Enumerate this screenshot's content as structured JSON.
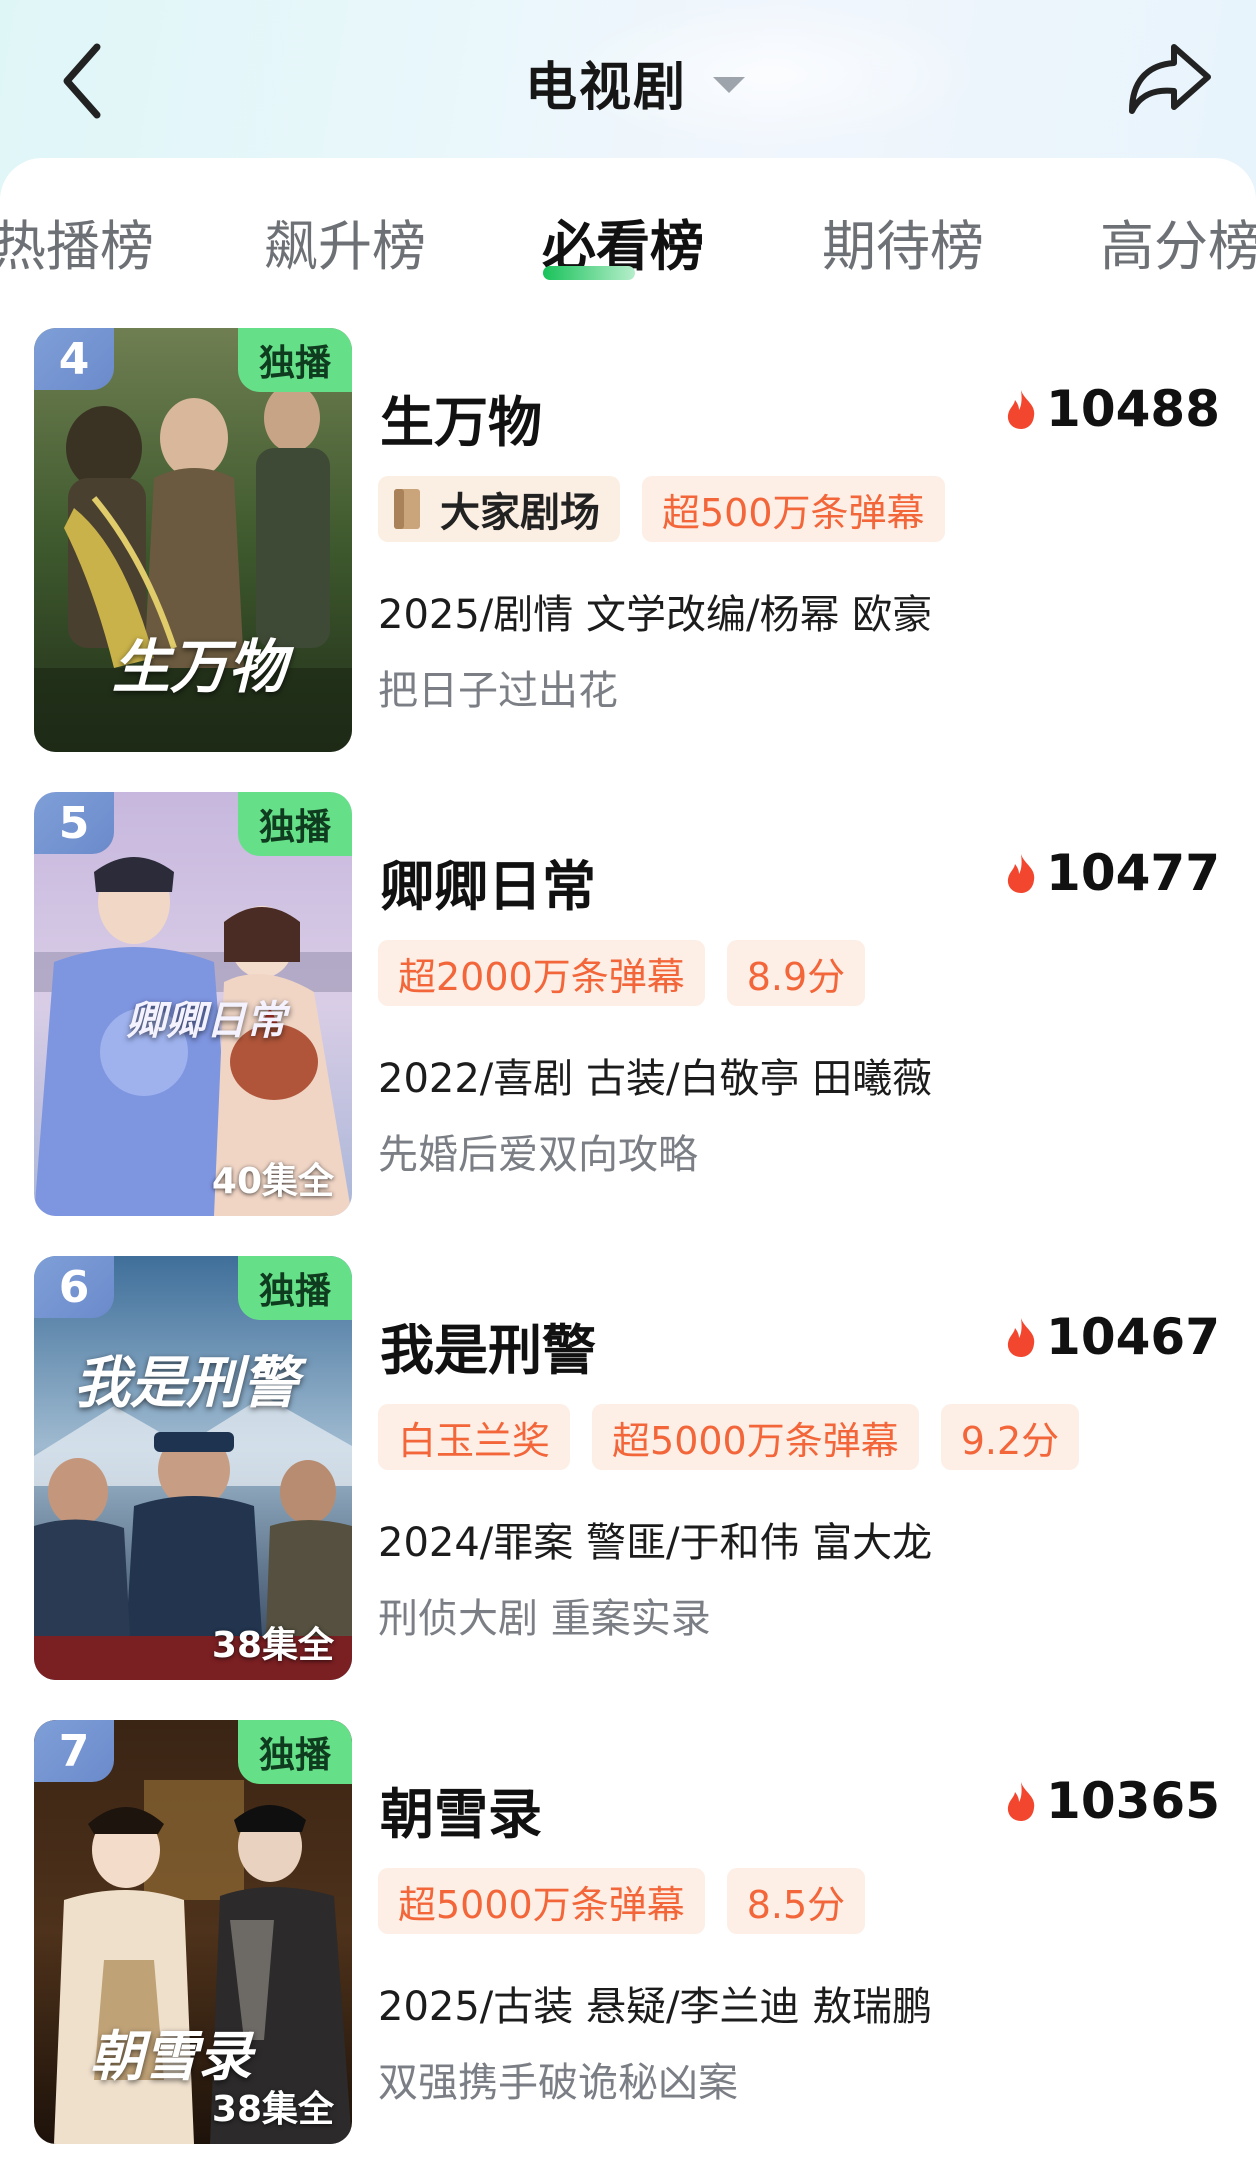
{
  "header": {
    "title": "电视剧",
    "back_icon": "chevron-left-icon",
    "share_icon": "share-arrow-icon",
    "dropdown_icon": "caret-down-icon"
  },
  "tabs": [
    {
      "label": "热播榜",
      "active": false
    },
    {
      "label": "飙升榜",
      "active": false
    },
    {
      "label": "必看榜",
      "active": true
    },
    {
      "label": "期待榜",
      "active": false
    },
    {
      "label": "高分榜",
      "active": false
    }
  ],
  "accent_color": "#19c25a",
  "heat_icon": "flame-icon",
  "items": [
    {
      "rank": "4",
      "badge": "独播",
      "poster_title": "生万物",
      "episodes": "",
      "name": "生万物",
      "heat": "10488",
      "brand_tag": "大家剧场",
      "tags": [
        "超500万条弹幕"
      ],
      "meta": "2025/剧情 文学改编/杨幂 欧豪",
      "desc": "把日子过出花"
    },
    {
      "rank": "5",
      "badge": "独播",
      "poster_title": "卿卿日常",
      "episodes": "40集全",
      "name": "卿卿日常",
      "heat": "10477",
      "brand_tag": "",
      "tags": [
        "超2000万条弹幕",
        "8.9分"
      ],
      "meta": "2022/喜剧 古装/白敬亭 田曦薇",
      "desc": "先婚后爱双向攻略"
    },
    {
      "rank": "6",
      "badge": "独播",
      "poster_title": "我是刑警",
      "episodes": "38集全",
      "name": "我是刑警",
      "heat": "10467",
      "brand_tag": "",
      "tags": [
        "白玉兰奖",
        "超5000万条弹幕",
        "9.2分"
      ],
      "meta": "2024/罪案 警匪/于和伟 富大龙",
      "desc": "刑侦大剧 重案实录"
    },
    {
      "rank": "7",
      "badge": "独播",
      "poster_title": "朝雪录",
      "episodes": "38集全",
      "name": "朝雪录",
      "heat": "10365",
      "brand_tag": "",
      "tags": [
        "超5000万条弹幕",
        "8.5分"
      ],
      "meta": "2025/古装 悬疑/李兰迪 敖瑞鹏",
      "desc": "双强携手破诡秘凶案"
    }
  ]
}
